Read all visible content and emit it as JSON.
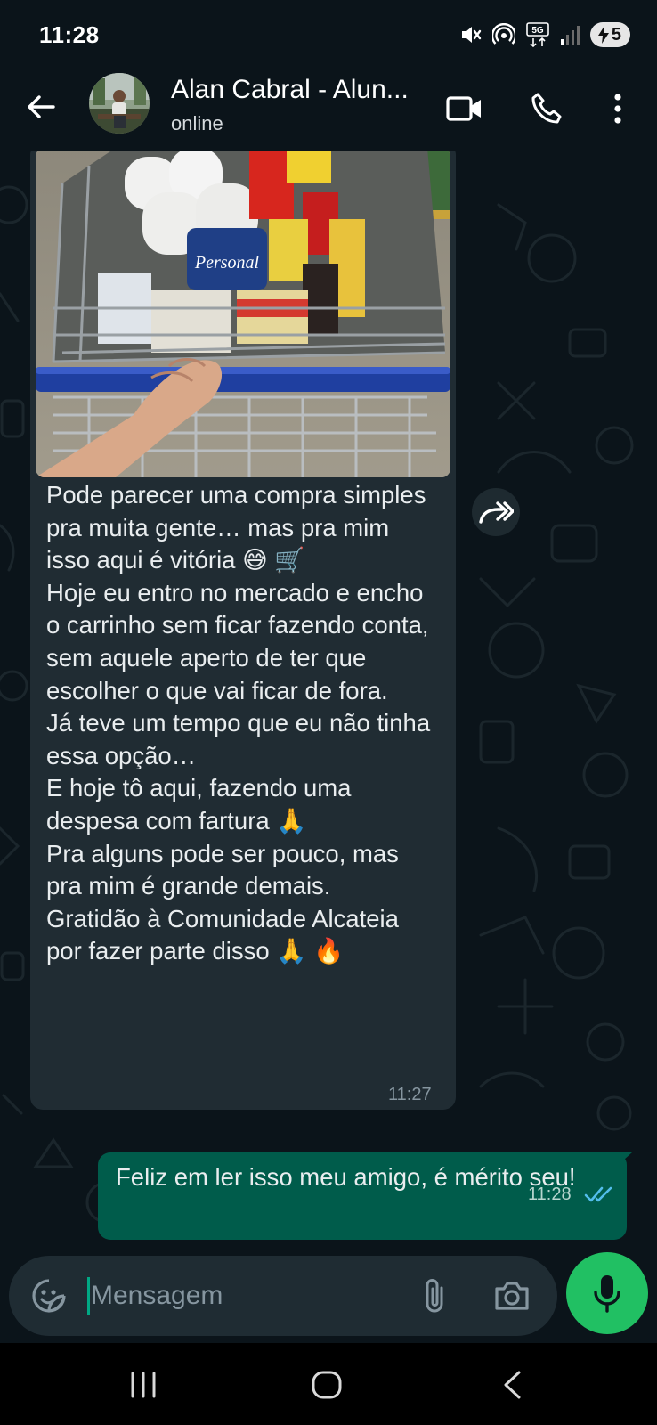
{
  "status_bar": {
    "time": "11:28",
    "battery": "5",
    "network": "5G"
  },
  "header": {
    "contact_name": "Alan Cabral - Alun...",
    "contact_status": "online"
  },
  "incoming_message": {
    "paragraphs": [
      "Pode parecer uma compra simples pra muita gente… mas pra mim isso aqui é vitória 😅 🛒",
      "Hoje eu entro no mercado e encho o carrinho sem ficar fazendo conta, sem aquele aperto de ter que escolher o que vai ficar de fora.",
      "Já teve um tempo que eu não tinha essa opção…",
      "E hoje tô aqui, fazendo uma despesa com fartura 🙏",
      "Pra alguns pode ser pouco, mas pra mim é grande demais.",
      "Gratidão à Comunidade Alcateia por fazer parte disso 🙏 🔥"
    ],
    "time": "11:27"
  },
  "outgoing_message": {
    "text": "Feliz em ler isso meu amigo, é mérito seu!",
    "time": "11:28",
    "status": "read"
  },
  "composer": {
    "placeholder": "Mensagem"
  },
  "icons": {
    "back": "arrow-left-icon",
    "video": "video-call-icon",
    "phone": "phone-call-icon",
    "menu": "more-vert-icon",
    "forward": "forward-icon",
    "emoji": "sticker-emoji-icon",
    "attach": "paperclip-icon",
    "camera": "camera-icon",
    "mic": "microphone-icon"
  },
  "colors": {
    "background": "#0b141a",
    "incoming_bubble": "#202c33",
    "outgoing_bubble": "#005c4b",
    "accent": "#21c063",
    "read_ticks": "#53bdeb"
  }
}
